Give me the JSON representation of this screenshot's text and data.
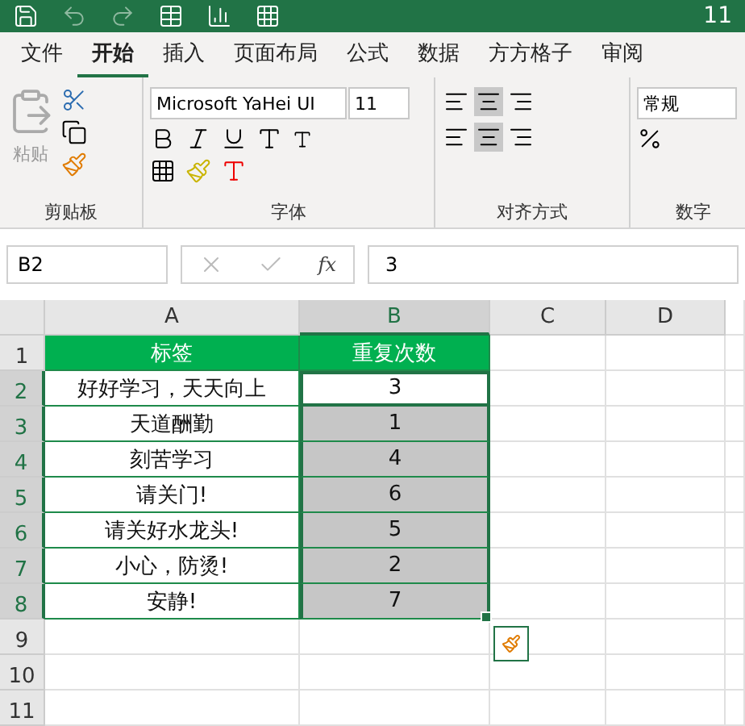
{
  "title_bar": {
    "text": "11"
  },
  "ribbon_tabs": [
    {
      "label": "文件",
      "selected": false
    },
    {
      "label": "开始",
      "selected": true
    },
    {
      "label": "插入",
      "selected": false
    },
    {
      "label": "页面布局",
      "selected": false
    },
    {
      "label": "公式",
      "selected": false
    },
    {
      "label": "数据",
      "selected": false
    },
    {
      "label": "方方格子",
      "selected": false
    },
    {
      "label": "审阅",
      "selected": false
    }
  ],
  "ribbon": {
    "clipboard": {
      "paste_label": "粘贴",
      "label": "剪贴板"
    },
    "font": {
      "font_name": "Microsoft YaHei UI",
      "font_size": "11",
      "label": "字体"
    },
    "alignment": {
      "label": "对齐方式"
    },
    "number": {
      "format": "常规",
      "label": "数字"
    }
  },
  "formula_bar": {
    "name_box": "B2",
    "function_label": "fx",
    "value": "3"
  },
  "columns": [
    {
      "label": "A",
      "selected": false
    },
    {
      "label": "B",
      "selected": true
    },
    {
      "label": "C",
      "selected": false
    },
    {
      "label": "D",
      "selected": false
    }
  ],
  "rows": [
    {
      "number": "1",
      "selected": false,
      "cells": [
        {
          "text": "标签",
          "kind": "header",
          "selected": false,
          "active": false
        },
        {
          "text": "重复次数",
          "kind": "header",
          "selected": false,
          "active": false
        }
      ]
    },
    {
      "number": "2",
      "selected": true,
      "cells": [
        {
          "text": "好好学习，天天向上",
          "kind": "data",
          "selected": false,
          "active": false
        },
        {
          "text": "3",
          "kind": "data",
          "selected": true,
          "active": true
        }
      ]
    },
    {
      "number": "3",
      "selected": true,
      "cells": [
        {
          "text": "天道酬勤",
          "kind": "data",
          "selected": false,
          "active": false
        },
        {
          "text": "1",
          "kind": "data",
          "selected": true,
          "active": false
        }
      ]
    },
    {
      "number": "4",
      "selected": true,
      "cells": [
        {
          "text": "刻苦学习",
          "kind": "data",
          "selected": false,
          "active": false
        },
        {
          "text": "4",
          "kind": "data",
          "selected": true,
          "active": false
        }
      ]
    },
    {
      "number": "5",
      "selected": true,
      "cells": [
        {
          "text": "请关门!",
          "kind": "data",
          "selected": false,
          "active": false
        },
        {
          "text": "6",
          "kind": "data",
          "selected": true,
          "active": false
        }
      ]
    },
    {
      "number": "6",
      "selected": true,
      "cells": [
        {
          "text": "请关好水龙头!",
          "kind": "data",
          "selected": false,
          "active": false
        },
        {
          "text": "5",
          "kind": "data",
          "selected": true,
          "active": false
        }
      ]
    },
    {
      "number": "7",
      "selected": true,
      "cells": [
        {
          "text": "小心，防烫!",
          "kind": "data",
          "selected": false,
          "active": false
        },
        {
          "text": "2",
          "kind": "data",
          "selected": true,
          "active": false
        }
      ]
    },
    {
      "number": "8",
      "selected": true,
      "cells": [
        {
          "text": "安静!",
          "kind": "data",
          "selected": false,
          "active": false
        },
        {
          "text": "7",
          "kind": "data",
          "selected": true,
          "active": false
        }
      ]
    },
    {
      "number": "9",
      "selected": false,
      "cells": []
    },
    {
      "number": "10",
      "selected": false,
      "cells": []
    },
    {
      "number": "11",
      "selected": false,
      "cells": []
    }
  ]
}
